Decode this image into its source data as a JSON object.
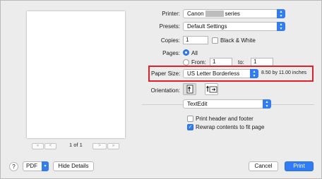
{
  "pager": {
    "first": "«",
    "prev": "<",
    "page_text": "1 of 1",
    "next": ">",
    "last": "»"
  },
  "printer": {
    "label": "Printer:",
    "prefix": "Canon",
    "suffix": "series"
  },
  "presets": {
    "label": "Presets:",
    "value": "Default Settings"
  },
  "copies": {
    "label": "Copies:",
    "value": "1",
    "bw_label": "Black & White"
  },
  "pages": {
    "label": "Pages:",
    "all_label": "All",
    "from_label": "From:",
    "from_value": "1",
    "to_label": "to:",
    "to_value": "1"
  },
  "paper_size": {
    "label": "Paper Size:",
    "value": "US Letter Borderless",
    "dimensions": "8.50 by 11.00 inches"
  },
  "orientation": {
    "label": "Orientation:"
  },
  "app_section": {
    "value": "TextEdit"
  },
  "options": {
    "header_footer": "Print header and footer",
    "rewrap": "Rewrap contents to fit page"
  },
  "footer": {
    "help": "?",
    "pdf": "PDF",
    "hide_details": "Hide Details",
    "cancel": "Cancel",
    "print": "Print"
  },
  "colors": {
    "accent": "#2f7cf6",
    "highlight_border": "#e0202a"
  }
}
